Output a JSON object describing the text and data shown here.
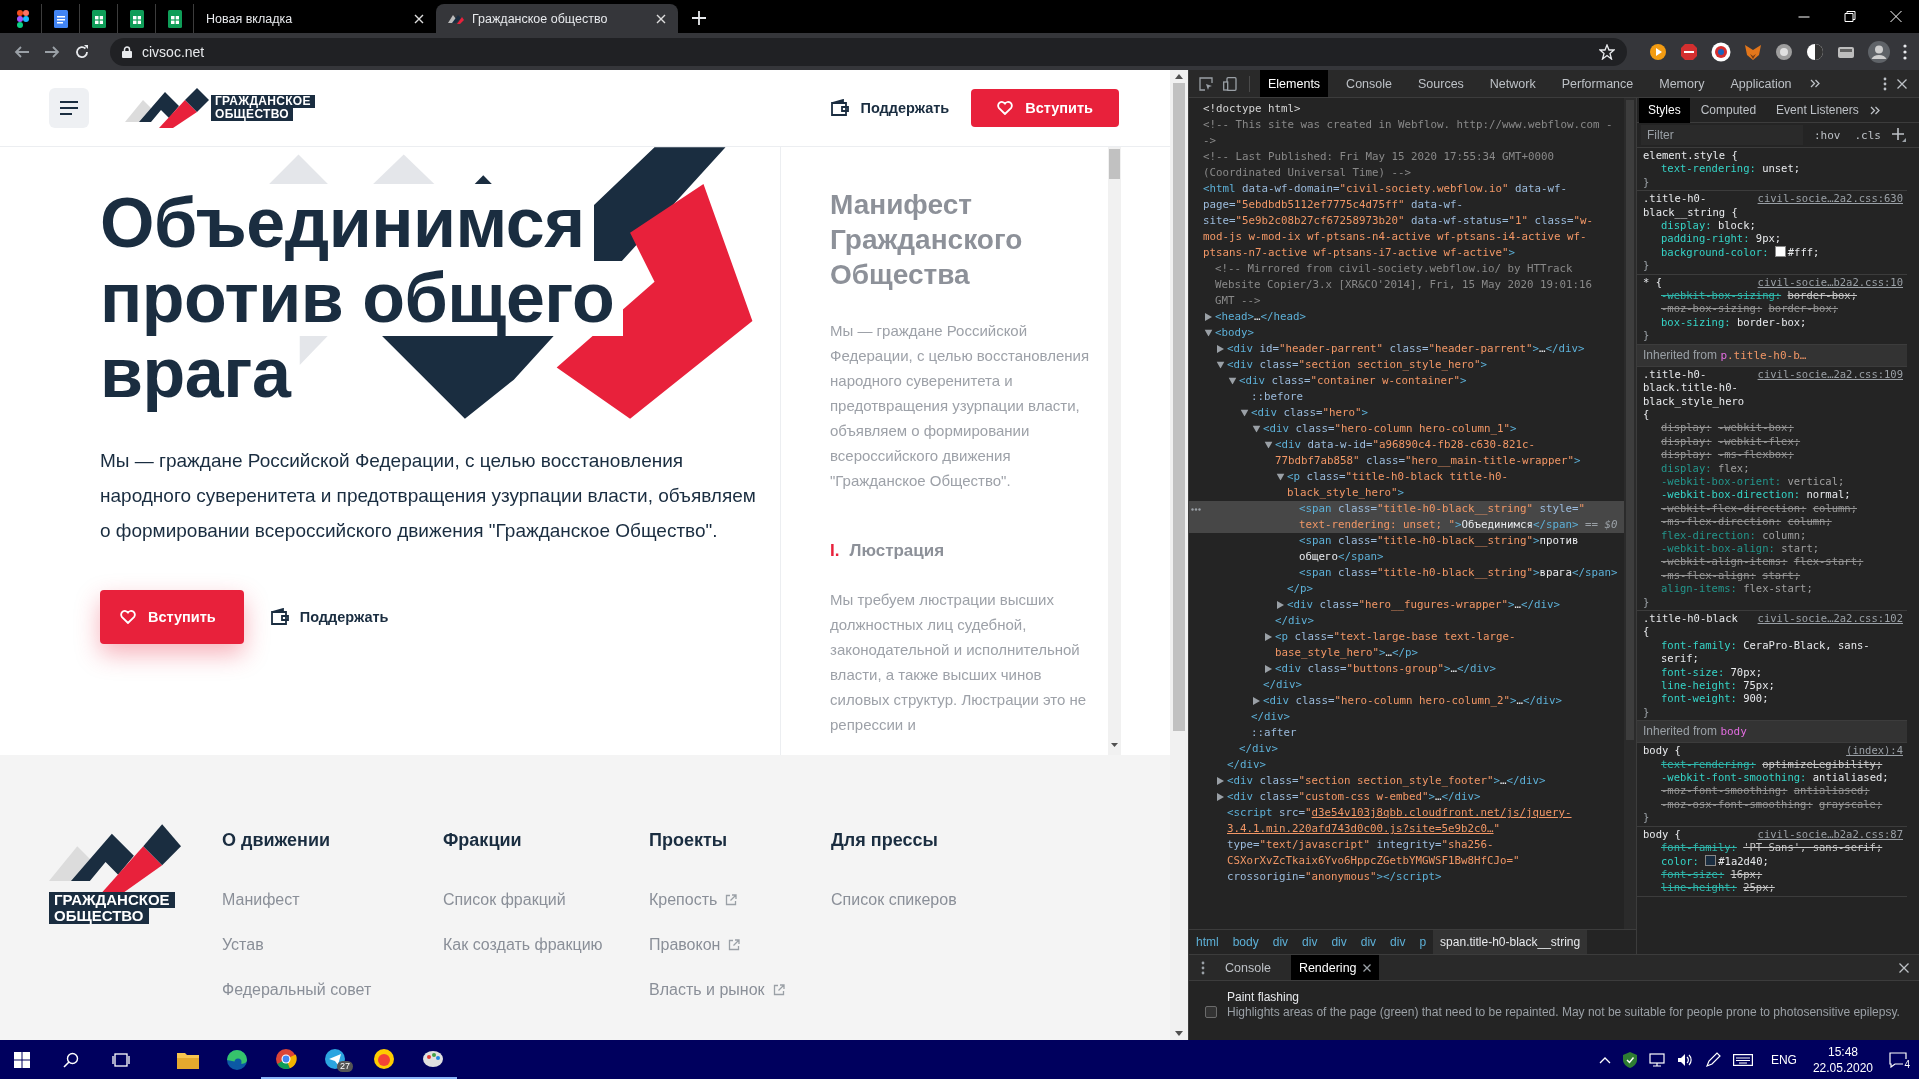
{
  "browser": {
    "tabs": [
      {
        "kind": "pinned",
        "selected": false
      },
      {
        "kind": "pinned",
        "selected": false
      },
      {
        "kind": "pinned",
        "selected": false
      },
      {
        "kind": "pinned",
        "selected": false
      },
      {
        "kind": "pinned",
        "selected": false
      },
      {
        "kind": "page",
        "label": "Новая вкладка",
        "selected": false
      },
      {
        "kind": "page",
        "label": "Гражданское общество",
        "selected": true
      }
    ],
    "address": "civsoc.net"
  },
  "site": {
    "header": {
      "logo": [
        "ГРАЖДАНСКОЕ",
        "ОБЩЕСТВО"
      ],
      "support": "Поддержать",
      "join": "Вступить"
    },
    "hero": {
      "title": [
        "Объединимся",
        "против общего",
        "врага"
      ],
      "text": "Мы — граждане Российской Федерации, с целью восстановления народного суверенитета и предотвращения узурпации власти, объявляем о формировании всероссийского движения \"Гражданское Общество\".",
      "join": "Вступить",
      "support": "Поддержать"
    },
    "manifest": {
      "title": "Манифест Гражданского Общества",
      "intro": "Мы — граждане Российской Федерации, с целью восстановления народного суверенитета и предотвращения узурпации власти, объявляем о формировании всероссийского движения \"Гражданское Общество\".",
      "sections": [
        {
          "number": "I.",
          "title": "Люстрация",
          "text": "Мы требуем люстрации высших должностных лиц судебной, законодательной и исполнительной власти, а также высших чинов силовых структур. Люстрации это не репрессии и"
        }
      ]
    },
    "footer": {
      "logo": [
        "ГРАЖДАНСКОЕ",
        "ОБЩЕСТВО"
      ],
      "columns": [
        {
          "title": "О движении",
          "links": [
            {
              "label": "Манифест",
              "external": false
            },
            {
              "label": "Устав",
              "external": false
            },
            {
              "label": "Федеральный совет",
              "external": false
            }
          ]
        },
        {
          "title": "Фракции",
          "links": [
            {
              "label": "Список фракций",
              "external": false
            },
            {
              "label": "Как создать фракцию",
              "external": false
            }
          ]
        },
        {
          "title": "Проекты",
          "links": [
            {
              "label": "Крепость",
              "external": true
            },
            {
              "label": "Правокон",
              "external": true
            },
            {
              "label": "Власть и рынок",
              "external": true
            }
          ]
        },
        {
          "title": "Для прессы",
          "links": [
            {
              "label": "Список спикеров",
              "external": false
            }
          ]
        }
      ]
    }
  },
  "devtools": {
    "tabs": [
      {
        "label": "Elements",
        "selected": true
      },
      {
        "label": "Console",
        "selected": false
      },
      {
        "label": "Sources",
        "selected": false
      },
      {
        "label": "Network",
        "selected": false
      },
      {
        "label": "Performance",
        "selected": false
      },
      {
        "label": "Memory",
        "selected": false
      },
      {
        "label": "Application",
        "selected": false
      }
    ],
    "dom": [
      {
        "selected": false,
        "parts": [
          {
            "kind": "doctype",
            "text": "<!doctype html>"
          }
        ]
      },
      {
        "selected": false,
        "parts": [
          {
            "kind": "comment",
            "text": "<!-- This site was created in Webflow. http://www.webflow.com -->"
          }
        ]
      },
      {
        "selected": false,
        "parts": [
          {
            "kind": "comment",
            "text": "<!-- Last Published: Fri May 15 2020 17:55:34 GMT+0000 (Coordinated Universal Time) -->"
          }
        ]
      },
      {
        "selected": false,
        "parts": [
          {
            "kind": "tag",
            "text": "<html"
          },
          {
            "kind": "attr",
            "text": " data-wf-domain="
          },
          {
            "kind": "value",
            "text": "\"civil-society.webflow.io\""
          },
          {
            "kind": "attr",
            "text": " data-wf-page="
          },
          {
            "kind": "value",
            "text": "\"5ebdbdb5112ef7775c4d75ff\""
          },
          {
            "kind": "attr",
            "text": " data-wf-site="
          },
          {
            "kind": "value",
            "text": "\"5e9b2c08b27cf67258973b20\""
          },
          {
            "kind": "attr",
            "text": " data-wf-status="
          },
          {
            "kind": "value",
            "text": "\"1\""
          },
          {
            "kind": "attr",
            "text": " class="
          },
          {
            "kind": "value",
            "text": "\"w-mod-js w-mod-ix wf-ptsans-n4-active wf-ptsans-i4-active wf-ptsans-n7-active wf-ptsans-i7-active wf-active\""
          },
          {
            "kind": "tag",
            "text": ">"
          }
        ],
        "children": [
          {
            "selected": false,
            "parts": [
              {
                "kind": "comment",
                "text": "<!-- Mirrored from civil-society.webflow.io/ by HTTrack Website Copier/3.x [XR&CO'2014], Fri, 15 May 2020 19:01:16 GMT -->"
              }
            ]
          },
          {
            "selected": false,
            "expanded": false,
            "parts": [
              {
                "kind": "tag",
                "text": "<head>"
              },
              {
                "kind": "text",
                "text": "…"
              },
              {
                "kind": "tag",
                "text": "</head>"
              }
            ]
          },
          {
            "selected": false,
            "expanded": true,
            "parts": [
              {
                "kind": "tag",
                "text": "<body>"
              }
            ],
            "children": [
              {
                "selected": false,
                "expanded": false,
                "parts": [
                  {
                    "kind": "tag",
                    "text": "<div"
                  },
                  {
                    "kind": "attr",
                    "text": " id="
                  },
                  {
                    "kind": "value",
                    "text": "\"header-parrent\""
                  },
                  {
                    "kind": "attr",
                    "text": " class="
                  },
                  {
                    "kind": "value",
                    "text": "\"header-parrent\""
                  },
                  {
                    "kind": "tag",
                    "text": ">"
                  },
                  {
                    "kind": "text",
                    "text": "…"
                  },
                  {
                    "kind": "tag",
                    "text": "</div>"
                  }
                ]
              },
              {
                "selected": false,
                "expanded": true,
                "parts": [
                  {
                    "kind": "tag",
                    "text": "<div"
                  },
                  {
                    "kind": "attr",
                    "text": " class="
                  },
                  {
                    "kind": "value",
                    "text": "\"section section_style_hero\""
                  },
                  {
                    "kind": "tag",
                    "text": ">"
                  }
                ],
                "close": [
                  {
                    "kind": "tag",
                    "text": "</div>"
                  }
                ],
                "children": [
                  {
                    "selected": false,
                    "expanded": true,
                    "parts": [
                      {
                        "kind": "tag",
                        "text": "<div"
                      },
                      {
                        "kind": "attr",
                        "text": " class="
                      },
                      {
                        "kind": "value",
                        "text": "\"container w-container\""
                      },
                      {
                        "kind": "tag",
                        "text": ">"
                      }
                    ],
                    "close": [
                      {
                        "kind": "tag",
                        "text": "</div>"
                      }
                    ],
                    "children": [
                      {
                        "selected": false,
                        "parts": [
                          {
                            "kind": "pseudo",
                            "text": "::before"
                          }
                        ]
                      },
                      {
                        "selected": false,
                        "expanded": true,
                        "parts": [
                          {
                            "kind": "tag",
                            "text": "<div"
                          },
                          {
                            "kind": "attr",
                            "text": " class="
                          },
                          {
                            "kind": "value",
                            "text": "\"hero\""
                          },
                          {
                            "kind": "tag",
                            "text": ">"
                          }
                        ],
                        "close": [
                          {
                            "kind": "tag",
                            "text": "</div>"
                          }
                        ],
                        "children": [
                          {
                            "selected": false,
                            "expanded": true,
                            "parts": [
                              {
                                "kind": "tag",
                                "text": "<div"
                              },
                              {
                                "kind": "attr",
                                "text": " class="
                              },
                              {
                                "kind": "value",
                                "text": "\"hero-column hero-column_1\""
                              },
                              {
                                "kind": "tag",
                                "text": ">"
                              }
                            ],
                            "close": [
                              {
                                "kind": "tag",
                                "text": "</div>"
                              }
                            ],
                            "children": [
                              {
                                "selected": false,
                                "expanded": true,
                                "parts": [
                                  {
                                    "kind": "tag",
                                    "text": "<div"
                                  },
                                  {
                                    "kind": "attr",
                                    "text": " data-w-id="
                                  },
                                  {
                                    "kind": "value",
                                    "text": "\"a96890c4-fb28-c630-821c-77bdbf7ab858\""
                                  },
                                  {
                                    "kind": "attr",
                                    "text": " class="
                                  },
                                  {
                                    "kind": "value",
                                    "text": "\"hero__main-title-wrapper\""
                                  },
                                  {
                                    "kind": "tag",
                                    "text": ">"
                                  }
                                ],
                                "close": [
                                  {
                                    "kind": "tag",
                                    "text": "</div>"
                                  }
                                ],
                                "children": [
                                  {
                                    "selected": false,
                                    "expanded": true,
                                    "parts": [
                                      {
                                        "kind": "tag",
                                        "text": "<p"
                                      },
                                      {
                                        "kind": "attr",
                                        "text": " class="
                                      },
                                      {
                                        "kind": "value",
                                        "text": "\"title-h0-black title-h0-black_style_hero\""
                                      },
                                      {
                                        "kind": "tag",
                                        "text": ">"
                                      }
                                    ],
                                    "close": [
                                      {
                                        "kind": "tag",
                                        "text": "</p>"
                                      }
                                    ],
                                    "children": [
                                      {
                                        "selected": true,
                                        "parts": [
                                          {
                                            "kind": "tag",
                                            "text": "<span"
                                          },
                                          {
                                            "kind": "attr",
                                            "text": " class="
                                          },
                                          {
                                            "kind": "value",
                                            "text": "\"title-h0-black__string\""
                                          },
                                          {
                                            "kind": "attr",
                                            "text": " style="
                                          },
                                          {
                                            "kind": "value",
                                            "text": "\" text-rendering: unset; \""
                                          },
                                          {
                                            "kind": "tag",
                                            "text": ">"
                                          },
                                          {
                                            "kind": "text",
                                            "text": "Объединимся"
                                          },
                                          {
                                            "kind": "tag",
                                            "text": "</span>"
                                          },
                                          {
                                            "kind": "marker",
                                            "text": " == $0"
                                          }
                                        ]
                                      },
                                      {
                                        "selected": false,
                                        "parts": [
                                          {
                                            "kind": "tag",
                                            "text": "<span"
                                          },
                                          {
                                            "kind": "attr",
                                            "text": " class="
                                          },
                                          {
                                            "kind": "value",
                                            "text": "\"title-h0-black__string\""
                                          },
                                          {
                                            "kind": "tag",
                                            "text": ">"
                                          },
                                          {
                                            "kind": "text",
                                            "text": "против общего"
                                          },
                                          {
                                            "kind": "tag",
                                            "text": "</span>"
                                          }
                                        ]
                                      },
                                      {
                                        "selected": false,
                                        "parts": [
                                          {
                                            "kind": "tag",
                                            "text": "<span"
                                          },
                                          {
                                            "kind": "attr",
                                            "text": " class="
                                          },
                                          {
                                            "kind": "value",
                                            "text": "\"title-h0-black__string\""
                                          },
                                          {
                                            "kind": "tag",
                                            "text": ">"
                                          },
                                          {
                                            "kind": "text",
                                            "text": "врага"
                                          },
                                          {
                                            "kind": "tag",
                                            "text": "</span>"
                                          }
                                        ]
                                      }
                                    ]
                                  },
                                  {
                                    "selected": false,
                                    "expanded": false,
                                    "parts": [
                                      {
                                        "kind": "tag",
                                        "text": "<div"
                                      },
                                      {
                                        "kind": "attr",
                                        "text": " class="
                                      },
                                      {
                                        "kind": "value",
                                        "text": "\"hero__fugures-wrapper\""
                                      },
                                      {
                                        "kind": "tag",
                                        "text": ">"
                                      },
                                      {
                                        "kind": "text",
                                        "text": "…"
                                      },
                                      {
                                        "kind": "tag",
                                        "text": "</div>"
                                      }
                                    ]
                                  }
                                ]
                              },
                              {
                                "selected": false,
                                "expanded": false,
                                "parts": [
                                  {
                                    "kind": "tag",
                                    "text": "<p"
                                  },
                                  {
                                    "kind": "attr",
                                    "text": " class="
                                  },
                                  {
                                    "kind": "value",
                                    "text": "\"text-large-base text-large-base_style_hero\""
                                  },
                                  {
                                    "kind": "tag",
                                    "text": ">"
                                  },
                                  {
                                    "kind": "text",
                                    "text": "…"
                                  },
                                  {
                                    "kind": "tag",
                                    "text": "</p>"
                                  }
                                ]
                              },
                              {
                                "selected": false,
                                "expanded": false,
                                "parts": [
                                  {
                                    "kind": "tag",
                                    "text": "<div"
                                  },
                                  {
                                    "kind": "attr",
                                    "text": " class="
                                  },
                                  {
                                    "kind": "value",
                                    "text": "\"buttons-group\""
                                  },
                                  {
                                    "kind": "tag",
                                    "text": ">"
                                  },
                                  {
                                    "kind": "text",
                                    "text": "…"
                                  },
                                  {
                                    "kind": "tag",
                                    "text": "</div>"
                                  }
                                ]
                              }
                            ]
                          },
                          {
                            "selected": false,
                            "expanded": false,
                            "parts": [
                              {
                                "kind": "tag",
                                "text": "<div"
                              },
                              {
                                "kind": "attr",
                                "text": " class="
                              },
                              {
                                "kind": "value",
                                "text": "\"hero-column hero-column_2\""
                              },
                              {
                                "kind": "tag",
                                "text": ">"
                              },
                              {
                                "kind": "text",
                                "text": "…"
                              },
                              {
                                "kind": "tag",
                                "text": "</div>"
                              }
                            ]
                          }
                        ]
                      },
                      {
                        "selected": false,
                        "parts": [
                          {
                            "kind": "pseudo",
                            "text": "::after"
                          }
                        ]
                      }
                    ]
                  }
                ]
              },
              {
                "selected": false,
                "expanded": false,
                "parts": [
                  {
                    "kind": "tag",
                    "text": "<div"
                  },
                  {
                    "kind": "attr",
                    "text": " class="
                  },
                  {
                    "kind": "value",
                    "text": "\"section section_style_footer\""
                  },
                  {
                    "kind": "tag",
                    "text": ">"
                  },
                  {
                    "kind": "text",
                    "text": "…"
                  },
                  {
                    "kind": "tag",
                    "text": "</div>"
                  }
                ]
              },
              {
                "selected": false,
                "expanded": false,
                "parts": [
                  {
                    "kind": "tag",
                    "text": "<div"
                  },
                  {
                    "kind": "attr",
                    "text": " class="
                  },
                  {
                    "kind": "value",
                    "text": "\"custom-css w-embed\""
                  },
                  {
                    "kind": "tag",
                    "text": ">"
                  },
                  {
                    "kind": "text",
                    "text": "…"
                  },
                  {
                    "kind": "tag",
                    "text": "</div>"
                  }
                ]
              },
              {
                "selected": false,
                "parts": [
                  {
                    "kind": "tag",
                    "text": "<script"
                  },
                  {
                    "kind": "attr",
                    "text": " src="
                  },
                  {
                    "kind": "value",
                    "text": "\""
                  },
                  {
                    "kind": "link",
                    "text": "d3e54v103j8qbb.cloudfront.net/js/jquery-3.4.1.min.220afd743d0c00.js?site=5e9b2c0…"
                  },
                  {
                    "kind": "value",
                    "text": "\""
                  },
                  {
                    "kind": "attr",
                    "text": " type="
                  },
                  {
                    "kind": "value",
                    "text": "\"text/javascript\""
                  },
                  {
                    "kind": "attr",
                    "text": " integrity="
                  },
                  {
                    "kind": "value",
                    "text": "\"sha256-CSXorXvZcTkaix6Yvo6HppcZGetbYMGWSF1Bw8HfCJo=\""
                  },
                  {
                    "kind": "attr",
                    "text": " crossorigin="
                  },
                  {
                    "kind": "value",
                    "text": "\"anonymous\""
                  },
                  {
                    "kind": "tag",
                    "text": "></script>"
                  }
                ]
              }
            ]
          }
        ]
      }
    ],
    "breadcrumb": [
      {
        "label": "html",
        "selected": false
      },
      {
        "label": "body",
        "selected": false
      },
      {
        "label": "div",
        "selected": false
      },
      {
        "label": "div",
        "selected": false
      },
      {
        "label": "div",
        "selected": false
      },
      {
        "label": "div",
        "selected": false
      },
      {
        "label": "div",
        "selected": false
      },
      {
        "label": "p",
        "selected": false
      },
      {
        "label": "span.title-h0-black__string",
        "selected": true
      }
    ],
    "sidebar_tabs": [
      {
        "label": "Styles",
        "selected": true
      },
      {
        "label": "Computed",
        "selected": false
      },
      {
        "label": "Event Listeners",
        "selected": false
      }
    ],
    "filter": {
      "placeholder": "Filter"
    },
    "hov": ":hov",
    "cls": ".cls",
    "rules": [
      {
        "kind": "rule",
        "selector": "element.style {",
        "close": "}",
        "props": [
          {
            "name": "text-rendering:",
            "value": "unset;",
            "struck": false,
            "dimmed": false
          }
        ]
      },
      {
        "kind": "rule",
        "selector": ".title-h0-black__string {",
        "source": "civil-socie…2a2.css:630",
        "close": "}",
        "props": [
          {
            "name": "display:",
            "value": "block;",
            "struck": false,
            "dimmed": false
          },
          {
            "name": "padding-right:",
            "value": "9px;",
            "struck": false,
            "dimmed": false
          },
          {
            "name": "background-color:",
            "value": "#fff;",
            "color": "#ffffff",
            "struck": false,
            "dimmed": false
          }
        ]
      },
      {
        "kind": "rule",
        "selector": "* {",
        "source": "civil-socie…b2a2.css:10",
        "close": "}",
        "props": [
          {
            "name": "-webkit-box-sizing:",
            "value": "border-box;",
            "struck": true,
            "dimmed": false
          },
          {
            "name": "-moz-box-sizing:",
            "value": "border-box;",
            "struck": true,
            "dimmed": true
          },
          {
            "name": "box-sizing:",
            "value": "border-box;",
            "struck": false,
            "dimmed": false
          }
        ]
      },
      {
        "kind": "inherited",
        "label": "Inherited from",
        "from": [
          {
            "kind": "tag",
            "text": "p"
          },
          {
            "kind": "cls",
            "text": ".title-h0-b…"
          }
        ]
      },
      {
        "kind": "rule",
        "selector": ".title-h0-black.title-h0-black_style_hero {",
        "source": "civil-socie…2a2.css:109",
        "close": "}",
        "props": [
          {
            "name": "display:",
            "value": "-webkit-box;",
            "struck": true,
            "dimmed": true
          },
          {
            "name": "display:",
            "value": "-webkit-flex;",
            "struck": true,
            "dimmed": true
          },
          {
            "name": "display:",
            "value": "-ms-flexbox;",
            "struck": true,
            "dimmed": true
          },
          {
            "name": "display:",
            "value": "flex;",
            "struck": false,
            "dimmed": true
          },
          {
            "name": "-webkit-box-orient:",
            "value": "vertical;",
            "struck": false,
            "dimmed": true
          },
          {
            "name": "-webkit-box-direction:",
            "value": "normal;",
            "struck": false,
            "dimmed": false
          },
          {
            "name": "-webkit-flex-direction:",
            "value": "column;",
            "struck": true,
            "dimmed": true
          },
          {
            "name": "-ms-flex-direction:",
            "value": "column;",
            "struck": true,
            "dimmed": true
          },
          {
            "name": "flex-direction:",
            "value": "column;",
            "struck": false,
            "dimmed": true
          },
          {
            "name": "-webkit-box-align:",
            "value": "start;",
            "struck": false,
            "dimmed": true
          },
          {
            "name": "-webkit-align-items:",
            "value": "flex-start;",
            "struck": true,
            "dimmed": true
          },
          {
            "name": "-ms-flex-align:",
            "value": "start;",
            "struck": true,
            "dimmed": true
          },
          {
            "name": "align-items:",
            "value": "flex-start;",
            "struck": false,
            "dimmed": true
          }
        ]
      },
      {
        "kind": "rule",
        "selector": ".title-h0-black {",
        "source": "civil-socie…2a2.css:102",
        "close": "}",
        "props": [
          {
            "name": "font-family:",
            "value": "CeraPro-Black, sans-serif;",
            "struck": false,
            "dimmed": false
          },
          {
            "name": "font-size:",
            "value": "70px;",
            "struck": false,
            "dimmed": false
          },
          {
            "name": "line-height:",
            "value": "75px;",
            "struck": false,
            "dimmed": false
          },
          {
            "name": "font-weight:",
            "value": "900;",
            "struck": false,
            "dimmed": false
          }
        ]
      },
      {
        "kind": "inherited",
        "label": "Inherited from",
        "from": [
          {
            "kind": "tag",
            "text": "body"
          }
        ]
      },
      {
        "kind": "rule",
        "selector": "body {",
        "source": "(index):4",
        "close": "}",
        "props": [
          {
            "name": "text-rendering:",
            "value": "optimizeLegibility;",
            "struck": true,
            "dimmed": false
          },
          {
            "name": "-webkit-font-smoothing:",
            "value": "antialiased;",
            "struck": false,
            "dimmed": false
          },
          {
            "name": "-moz-font-smoothing:",
            "value": "antialiased;",
            "struck": true,
            "dimmed": true
          },
          {
            "name": "-moz-osx-font-smoothing:",
            "value": "grayscale;",
            "struck": true,
            "dimmed": true
          }
        ]
      },
      {
        "kind": "rule",
        "selector": "body {",
        "source": "civil-socie…b2a2.css:87",
        "props": [
          {
            "name": "font-family:",
            "value": "'PT Sans', sans-serif;",
            "struck": true,
            "dimmed": false
          },
          {
            "name": "color:",
            "value": "#1a2d40;",
            "color": "#1a2d40",
            "struck": false,
            "dimmed": false
          },
          {
            "name": "font-size:",
            "value": "16px;",
            "struck": true,
            "dimmed": false
          },
          {
            "name": "line-height:",
            "value": "25px;",
            "struck": true,
            "dimmed": false
          }
        ]
      }
    ],
    "drawer": {
      "tabs": [
        {
          "label": "Console",
          "selected": false,
          "closable": false
        },
        {
          "label": "Rendering",
          "selected": true,
          "closable": true
        }
      ],
      "options": [
        {
          "title": "Paint flashing",
          "description": "Highlights areas of the page (green) that need to be repainted. May not be suitable for people prone to photosensitive epilepsy.",
          "checked": false
        }
      ]
    }
  },
  "taskbar": {
    "apps": [
      {
        "running": false
      },
      {
        "running": false
      },
      {
        "running": true
      },
      {
        "running": true,
        "badge": "27"
      },
      {
        "running": true
      },
      {
        "running": true
      }
    ],
    "language": "ENG",
    "time": "15:48",
    "date": "22.05.2020",
    "notifications": "4"
  }
}
